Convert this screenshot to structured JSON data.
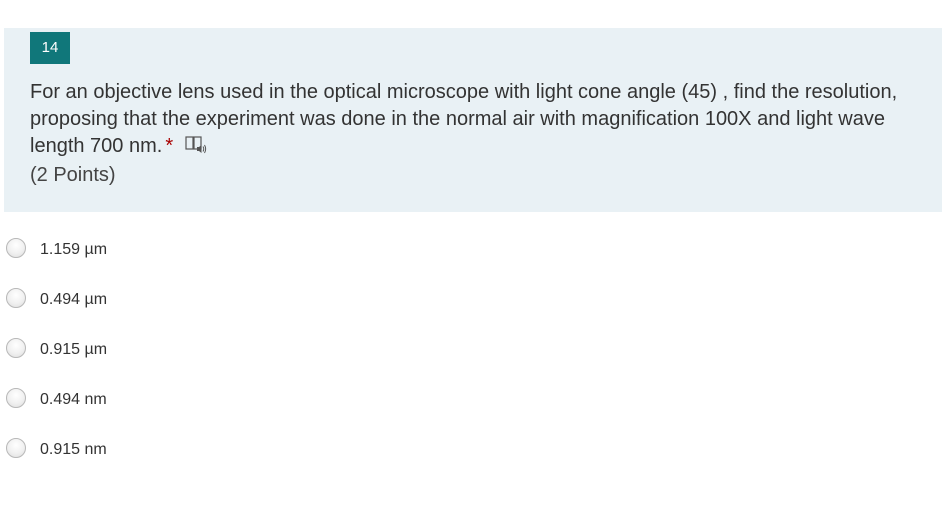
{
  "question": {
    "number": "14",
    "text": "For an objective lens used in the optical microscope with light cone angle (45) , find the resolution, proposing that the experiment was done in the normal air with magnification 100X and light wave length 700 nm.",
    "required_marker": "*",
    "points": "(2 Points)",
    "accent_color": "#10777a",
    "card_background": "#e9f1f5",
    "icon": "immersive-reader-icon"
  },
  "options": [
    {
      "label": "1.159 µm",
      "selected": false
    },
    {
      "label": "0.494 µm",
      "selected": false
    },
    {
      "label": "0.915 µm",
      "selected": false
    },
    {
      "label": "0.494 nm",
      "selected": false
    },
    {
      "label": "0.915 nm",
      "selected": false
    }
  ]
}
